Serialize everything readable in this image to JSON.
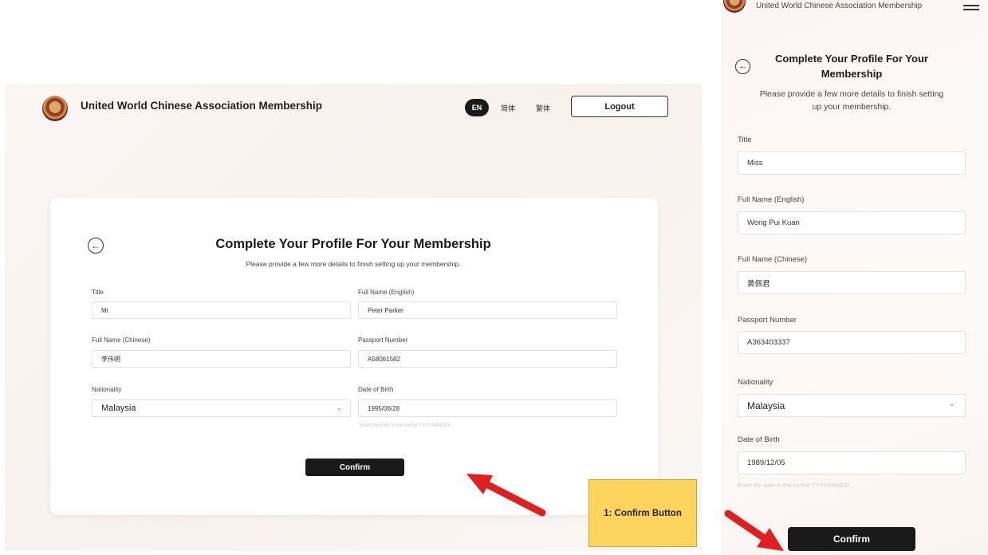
{
  "app": {
    "title": "United World Chinese Association Membership"
  },
  "languages": {
    "en": "EN",
    "simplified": "简体",
    "traditional": "繁体"
  },
  "header": {
    "logout_label": "Logout"
  },
  "form": {
    "heading": "Complete Your Profile For Your Membership",
    "subtitle": "Please provide a few more details to finish setting up your membership.",
    "date_hint": "Enter the date in the format YYYY/MM/DD.",
    "confirm_label": "Confirm",
    "labels": {
      "title": "Title",
      "name_en": "Full Name (English)",
      "name_zh": "Full Name (Chinese)",
      "passport": "Passport Number",
      "nationality": "Nationality",
      "dob": "Date of Birth"
    }
  },
  "desktop_values": {
    "title": "Mr",
    "name_en": "Peter Parker",
    "name_zh": "李伟明",
    "passport": "A58061582",
    "nationality": "Malaysia",
    "dob": "1995/06/28"
  },
  "mobile": {
    "header_title": "United World Chinese Association Membership",
    "values": {
      "title": "Miss",
      "name_en": "Wong Pui Kuan",
      "name_zh": "黄佩君",
      "passport": "A363403337",
      "nationality": "Malaysia",
      "dob": "1989/12/05"
    }
  },
  "annotation": {
    "callout": "1: Confirm Button",
    "arrow_color": "#e02020"
  },
  "colors": {
    "primary_button": "#1a1a1a",
    "callout_bg": "#fcd45e"
  }
}
